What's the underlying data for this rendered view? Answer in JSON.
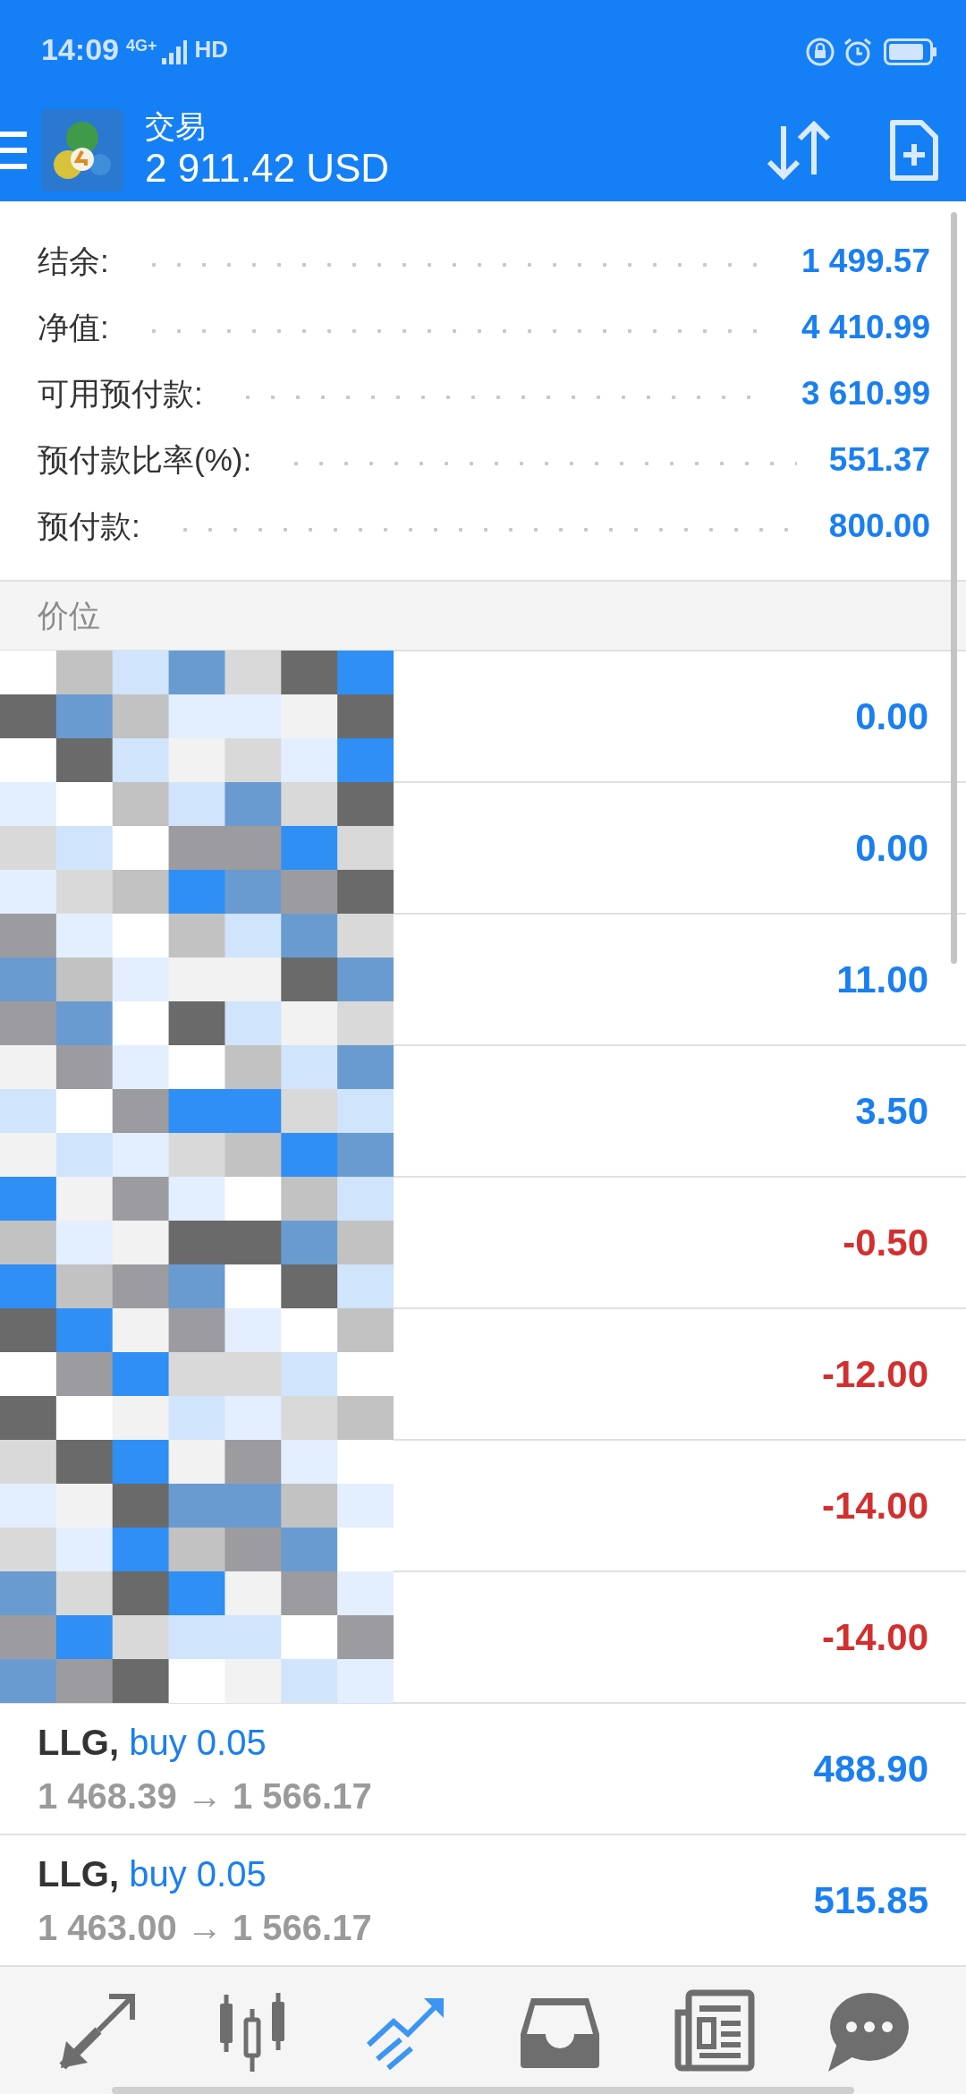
{
  "status_bar": {
    "time": "14:09",
    "network": "4G+",
    "hd": "HD"
  },
  "header": {
    "title": "交易",
    "balance": "2 911.42 USD"
  },
  "summary": [
    {
      "label": "结余:",
      "value": "1 499.57"
    },
    {
      "label": "净值:",
      "value": "4 410.99"
    },
    {
      "label": "可用预付款:",
      "value": "3 610.99"
    },
    {
      "label": "预付款比率(%):",
      "value": "551.37"
    },
    {
      "label": "预付款:",
      "value": "800.00"
    }
  ],
  "section_title": "价位",
  "positions": [
    {
      "kind": "redacted",
      "profit": "0.00",
      "color": "#1a7ff0"
    },
    {
      "kind": "redacted",
      "profit": "0.00",
      "color": "#1a7ff0"
    },
    {
      "kind": "redacted",
      "profit": "11.00",
      "color": "#1a7ff0"
    },
    {
      "kind": "redacted",
      "profit": "3.50",
      "color": "#1a7ff0"
    },
    {
      "kind": "redacted",
      "profit": "-0.50",
      "color": "#d32f2f"
    },
    {
      "kind": "redacted",
      "profit": "-12.00",
      "color": "#d32f2f"
    },
    {
      "kind": "redacted",
      "profit": "-14.00",
      "color": "#d32f2f"
    },
    {
      "kind": "redacted",
      "profit": "-14.00",
      "color": "#d32f2f"
    },
    {
      "kind": "position",
      "symbol": "LLG,",
      "order": "buy 0.05",
      "prices": "1 468.39 → 1 566.17",
      "profit": "488.90",
      "color": "#1a7ff0"
    },
    {
      "kind": "position",
      "symbol": "LLG,",
      "order": "buy 0.05",
      "prices": "1 463.00 → 1 566.17",
      "profit": "515.85",
      "color": "#1a7ff0"
    }
  ],
  "bottom_nav": [
    {
      "kind": "quotes",
      "selected": false
    },
    {
      "kind": "chart",
      "selected": false
    },
    {
      "kind": "trade",
      "selected": true
    },
    {
      "kind": "history",
      "selected": false
    },
    {
      "kind": "news",
      "selected": false
    },
    {
      "kind": "chat",
      "selected": false
    }
  ]
}
